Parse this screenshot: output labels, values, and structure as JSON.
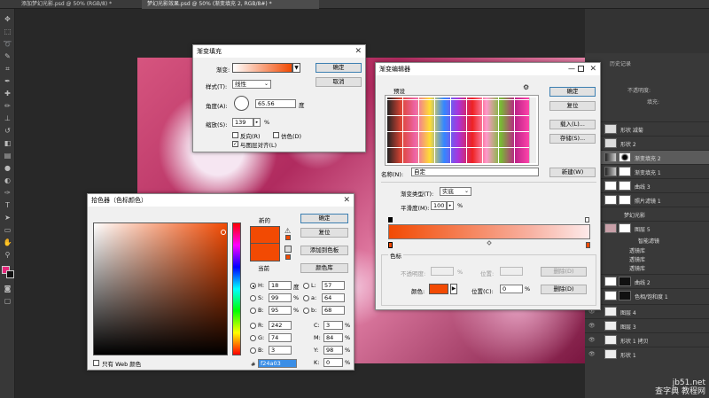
{
  "tabs": [
    {
      "label": "添加梦幻光影.psd @ 50% (RGB/8) *"
    },
    {
      "label": "梦幻光影效果.psd @ 50% (渐变填充 2, RGB/8#) *"
    }
  ],
  "history_tab": "历史记录",
  "layers_panel": {
    "opacity_label": "不透明度:",
    "fill_label": "填充:",
    "layers": [
      {
        "name": "形状 减菊"
      },
      {
        "name": "形状 2"
      },
      {
        "name": "渐变填充 2"
      },
      {
        "name": "渐变填充 1"
      },
      {
        "name": "曲线 3"
      },
      {
        "name": "照片滤镜 1"
      },
      {
        "name": "梦幻光影"
      },
      {
        "name": "图层 5"
      },
      {
        "name": "智能滤镜"
      },
      {
        "name": "透镜库"
      },
      {
        "name": "透镜库"
      },
      {
        "name": "透镜库"
      },
      {
        "name": "曲线 2"
      },
      {
        "name": "色相/饱和度 1"
      },
      {
        "name": "图层 4"
      },
      {
        "name": "图层 3"
      },
      {
        "name": "形状 1 拷贝"
      },
      {
        "name": "形状 1"
      }
    ]
  },
  "gradient_fill": {
    "title": "渐变填充",
    "gradient_label": "渐变:",
    "style_label": "样式(T):",
    "style_value": "线性",
    "angle_label": "角度(A):",
    "angle_value": "65.56",
    "angle_unit": "度",
    "scale_label": "缩放(S):",
    "scale_value": "139",
    "scale_unit": "%",
    "reverse_label": "反向(R)",
    "dither_label": "仿色(D)",
    "align_label": "与图层对齐(L)",
    "ok_label": "确定",
    "cancel_label": "取消"
  },
  "gradient_editor": {
    "title": "渐变编辑器",
    "presets_label": "预设",
    "ok_label": "确定",
    "reset_label": "复位",
    "load_label": "载入(L)...",
    "save_label": "存储(S)...",
    "name_label": "名称(N):",
    "name_value": "自定",
    "new_label": "新建(W)",
    "type_label": "渐变类型(T):",
    "type_value": "实底",
    "smooth_label": "平滑度(M):",
    "smooth_value": "100",
    "smooth_unit": "%",
    "stops_label": "色标",
    "opacity_label": "不透明度:",
    "opacity_unit": "%",
    "location_label": "位置:",
    "delete_label": "删除(D)",
    "color_label": "颜色:",
    "location2_label": "位置(C):",
    "location2_value": "0",
    "delete2_label": "删除(D)"
  },
  "color_picker": {
    "title": "拾色器（色标颜色）",
    "new_label": "新的",
    "current_label": "当前",
    "ok_label": "确定",
    "reset_label": "复位",
    "add_label": "添加到色板",
    "library_label": "颜色库",
    "h_label": "H:",
    "h_value": "18",
    "h_unit": "度",
    "s_label": "S:",
    "s_value": "99",
    "s_unit": "%",
    "b_label": "B:",
    "b_value": "95",
    "b_unit": "%",
    "r_label": "R:",
    "r_value": "242",
    "g_label": "G:",
    "g_value": "74",
    "bb_label": "B:",
    "bb_value": "3",
    "l_label": "L:",
    "l_value": "57",
    "a_label": "a:",
    "a_value": "64",
    "lb_label": "b:",
    "lb_value": "68",
    "c_label": "C:",
    "c_value": "3",
    "m_label": "M:",
    "m_value": "84",
    "y_label": "Y:",
    "y_value": "98",
    "k_label": "K:",
    "k_value": "0",
    "pct": "%",
    "hex_label": "#",
    "hex_value": "f24a03",
    "web_only_label": "只有 Web 颜色",
    "color": "#f24a03"
  },
  "watermark": {
    "line1": "jb51.net",
    "line2": "查字典 教程网"
  }
}
